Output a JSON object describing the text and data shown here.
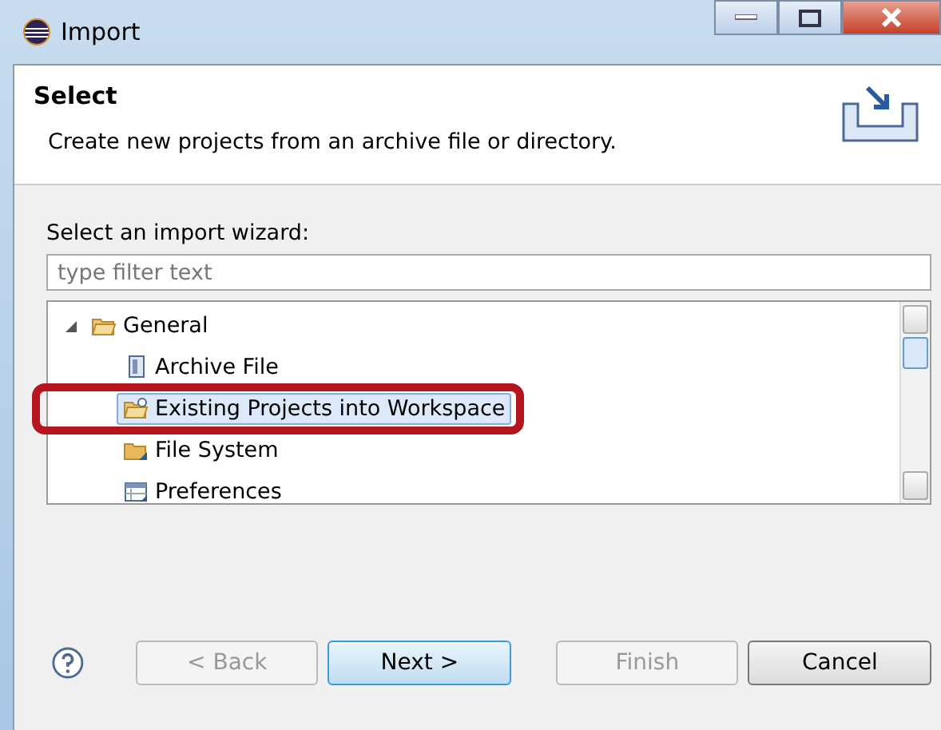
{
  "window": {
    "title": "Import"
  },
  "header": {
    "title": "Select",
    "description": "Create new projects from an archive file or directory."
  },
  "wizard_label": "Select an import wizard:",
  "filter": {
    "placeholder": "type filter text"
  },
  "tree": [
    {
      "label": "General",
      "kind": "folder",
      "expanded": true,
      "selected": false,
      "children": [
        {
          "label": "Archive File",
          "kind": "archive",
          "selected": false
        },
        {
          "label": "Existing Projects into Workspace",
          "kind": "project",
          "selected": true,
          "highlighted": true
        },
        {
          "label": "File System",
          "kind": "filesystem",
          "selected": false
        },
        {
          "label": "Preferences",
          "kind": "preferences",
          "selected": false
        }
      ]
    }
  ],
  "buttons": [
    {
      "label": "< Back",
      "disabled": true,
      "default": false
    },
    {
      "label": "Next >",
      "disabled": false,
      "default": true
    },
    {
      "label": "Finish",
      "disabled": true,
      "default": false
    },
    {
      "label": "Cancel",
      "disabled": false,
      "default": false
    }
  ]
}
